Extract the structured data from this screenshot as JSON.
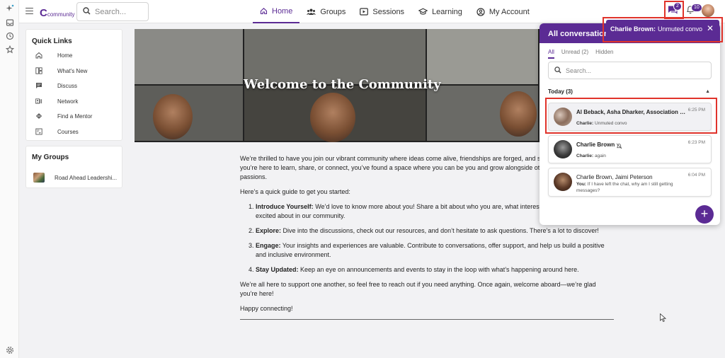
{
  "header": {
    "logo_mark": "C",
    "logo_word": "community",
    "search_placeholder": "Search...",
    "nav": [
      {
        "label": "Home",
        "icon": "home-icon",
        "active": true
      },
      {
        "label": "Groups",
        "icon": "groups-icon",
        "active": false
      },
      {
        "label": "Sessions",
        "icon": "sessions-icon",
        "active": false
      },
      {
        "label": "Learning",
        "icon": "learning-icon",
        "active": false
      },
      {
        "label": "My Account",
        "icon": "account-icon",
        "active": false
      }
    ],
    "messages_badge": "2",
    "notifications_badge": "10"
  },
  "sidebar": {
    "quick_links_title": "Quick Links",
    "quick_links": [
      {
        "label": "Home",
        "icon": "home-icon"
      },
      {
        "label": "What's New",
        "icon": "whats-new-icon"
      },
      {
        "label": "Discuss",
        "icon": "discuss-icon"
      },
      {
        "label": "Network",
        "icon": "network-icon"
      },
      {
        "label": "Find a Mentor",
        "icon": "mentor-icon"
      },
      {
        "label": "Courses",
        "icon": "courses-icon"
      }
    ],
    "groups_title": "My Groups",
    "groups": [
      {
        "label": "Road Ahead Leadershi..."
      }
    ]
  },
  "banner": {
    "title": "Welcome to the Community"
  },
  "article": {
    "intro_1": "We’re thrilled to have you join our vibrant community where ideas come alive, friendships are forged, and support matters. Whether you’re here to learn, share, or connect, you’ve found a space where you can be you and grow alongside others who share your passions.",
    "intro_2": "Here’s a quick guide to get you started:",
    "items": [
      {
        "title": "Introduce Yourself:",
        "text": " We’d love to know more about you! Share a bit about who you are, what interests you, and what you’re excited about in our community."
      },
      {
        "title": "Explore:",
        "text": " Dive into the discussions, check out our resources, and don’t hesitate to ask questions. There’s a lot to discover!"
      },
      {
        "title": "Engage:",
        "text": " Your insights and experiences are valuable. Contribute to conversations, offer support, and help us build a positive and inclusive environment."
      },
      {
        "title": "Stay Updated:",
        "text": " Keep an eye on announcements and events to stay in the loop with what’s happening around here."
      }
    ],
    "closing": "We’re all here to support one another, so feel free to reach out if you need anything. Once again, welcome aboard—we’re glad you’re here!",
    "signoff": "Happy connecting!"
  },
  "conversations": {
    "title": "All conversations",
    "tabs": [
      {
        "label": "All",
        "active": true
      },
      {
        "label": "Unread (2)",
        "active": false
      },
      {
        "label": "Hidden",
        "active": false
      }
    ],
    "search_placeholder": "Search...",
    "group_label": "Today (3)",
    "items": [
      {
        "name": "Al Beback, Asha Dharker, Association Sta...",
        "time": "6:25 PM",
        "sender": "Charlie:",
        "snippet": " Unmuted convo",
        "bold": true,
        "selected": true
      },
      {
        "name": "Charlie Brown",
        "time": "6:23 PM",
        "sender": "Charlie:",
        "snippet": " again",
        "bold": true,
        "muted": true
      },
      {
        "name": "Charlie Brown, Jaimi Peterson",
        "time": "6:04 PM",
        "sender": "You:",
        "snippet": " If I have left the chat, why am I still getting messages?",
        "bold": false
      }
    ]
  },
  "toast": {
    "sender": "Charlie Brown:",
    "message": "Unmuted convo"
  },
  "colors": {
    "brand": "#5b2b94",
    "highlight": "#e0332b"
  }
}
